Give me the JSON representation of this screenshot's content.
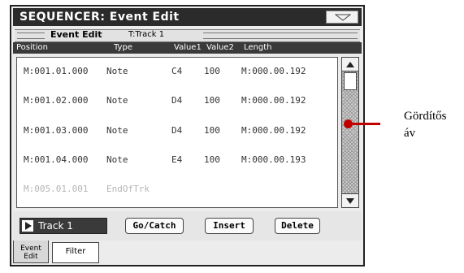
{
  "window": {
    "title": "SEQUENCER: Event Edit"
  },
  "subheader": {
    "label": "Event Edit",
    "track": "T:Track 1"
  },
  "columns": {
    "position": "Position",
    "type": "Type",
    "value1": "Value1",
    "value2": "Value2",
    "length": "Length"
  },
  "rows": [
    {
      "position": "M:001.01.000",
      "type": "Note",
      "value1": "C4",
      "value2": "100",
      "length": "M:000.00.192"
    },
    {
      "position": "M:001.02.000",
      "type": "Note",
      "value1": "D4",
      "value2": "100",
      "length": "M:000.00.192"
    },
    {
      "position": "M:001.03.000",
      "type": "Note",
      "value1": "D4",
      "value2": "100",
      "length": "M:000.00.192"
    },
    {
      "position": "M:001.04.000",
      "type": "Note",
      "value1": "E4",
      "value2": "100",
      "length": "M:000.00.193"
    },
    {
      "position": "M:005.01.001",
      "type": "EndOfTrk",
      "value1": "",
      "value2": "",
      "length": ""
    }
  ],
  "controls": {
    "track_select": "Track 1",
    "go_catch": "Go/Catch",
    "insert": "Insert",
    "delete": "Delete"
  },
  "tabs": {
    "event_line1": "Event",
    "event_line2": "Edit",
    "filter": "Filter"
  },
  "callout": {
    "line1": "Gördítős",
    "line2": "áv"
  },
  "colors": {
    "accent": "#c00000",
    "titlebar": "#2b2b2b"
  }
}
